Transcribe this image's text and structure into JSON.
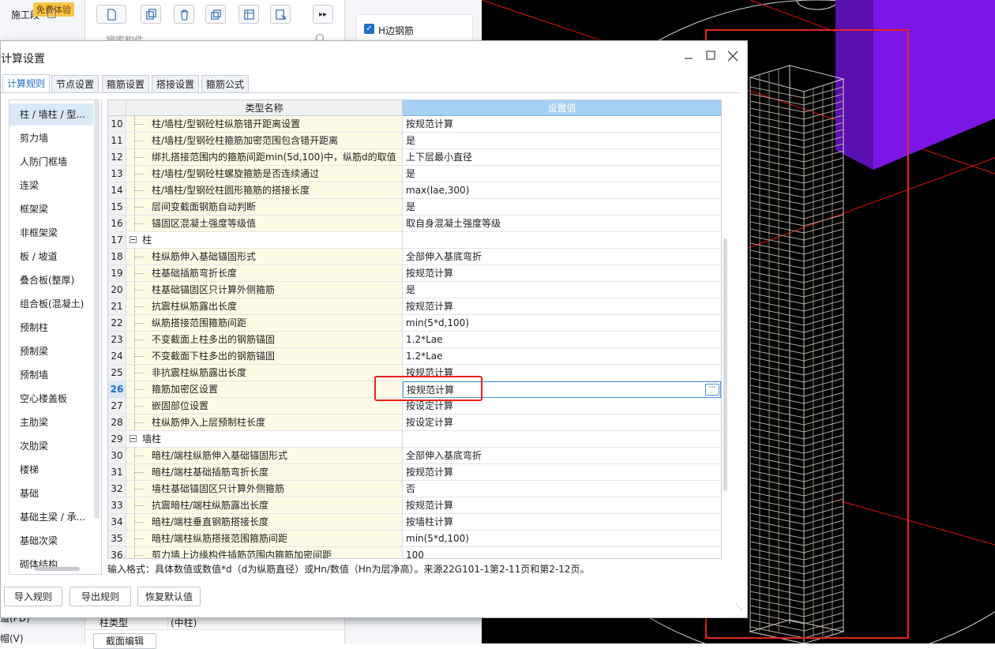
{
  "background": {
    "left_panel": {
      "stage_label": "施工段",
      "trial_badge": "免费体验",
      "bottom_items": [
        "道(PD)",
        "帽(V)"
      ]
    },
    "middle_panel": {
      "search_placeholder": "搜索构件",
      "prop_row": {
        "name": "柱类型",
        "value": "(中柱)"
      },
      "bottom_button": "截面编辑"
    },
    "property_panel": {
      "checkbox_label": "H边钢筋",
      "checked": true
    }
  },
  "dialog": {
    "title": "计算设置",
    "tabs": [
      {
        "label": "计算规则",
        "active": true
      },
      {
        "label": "节点设置"
      },
      {
        "label": "箍筋设置"
      },
      {
        "label": "搭接设置"
      },
      {
        "label": "箍筋公式"
      }
    ],
    "categories": [
      "柱 / 墙柱 / 型...",
      "剪力墙",
      "人防门框墙",
      "连梁",
      "框架梁",
      "非框架梁",
      "板 / 坡道",
      "叠合板(整厚)",
      "组合板(混凝土)",
      "预制柱",
      "预制梁",
      "预制墙",
      "空心楼盖板",
      "主肋梁",
      "次肋梁",
      "楼梯",
      "基础",
      "基础主梁 / 承...",
      "基础次梁",
      "砌体结构"
    ],
    "grid": {
      "col_name": "类型名称",
      "col_value": "设置值",
      "rows": [
        {
          "num": "10",
          "name": "柱/墙柱/型钢砼柱纵筋错开距离设置",
          "value": "按规范计算"
        },
        {
          "num": "11",
          "name": "柱/墙柱/型钢砼柱箍筋加密范围包含错开距离",
          "value": "是"
        },
        {
          "num": "12",
          "name": "绑扎搭接范围内的箍筋间距min(5d,100)中，纵筋d的取值",
          "value": "上下层最小直径"
        },
        {
          "num": "13",
          "name": "柱/墙柱/型钢砼柱螺旋箍筋是否连续通过",
          "value": "是"
        },
        {
          "num": "14",
          "name": "柱/墙柱/型钢砼柱圆形箍筋的搭接长度",
          "value": "max(lae,300)"
        },
        {
          "num": "15",
          "name": "层间变截面钢筋自动判断",
          "value": "是"
        },
        {
          "num": "16",
          "name": "锚固区混凝土强度等级值",
          "value": "取自身混凝土强度等级"
        },
        {
          "num": "17",
          "name": "柱",
          "value": "",
          "group": true
        },
        {
          "num": "18",
          "name": "柱纵筋伸入基础锚固形式",
          "value": "全部伸入基底弯折"
        },
        {
          "num": "19",
          "name": "柱基础插筋弯折长度",
          "value": "按规范计算"
        },
        {
          "num": "20",
          "name": "柱基础锚固区只计算外侧箍筋",
          "value": "是"
        },
        {
          "num": "21",
          "name": "抗震柱纵筋露出长度",
          "value": "按规范计算"
        },
        {
          "num": "22",
          "name": "纵筋搭接范围箍筋间距",
          "value": "min(5*d,100)"
        },
        {
          "num": "23",
          "name": "不变截面上柱多出的钢筋锚固",
          "value": "1.2*Lae"
        },
        {
          "num": "24",
          "name": "不变截面下柱多出的钢筋锚固",
          "value": "1.2*Lae"
        },
        {
          "num": "25",
          "name": "非抗震柱纵筋露出长度",
          "value": "按规范计算"
        },
        {
          "num": "26",
          "name": "箍筋加密区设置",
          "value": "按规范计算",
          "selected": true
        },
        {
          "num": "27",
          "name": "嵌固部位设置",
          "value": "按设定计算"
        },
        {
          "num": "28",
          "name": "柱纵筋伸入上层预制柱长度",
          "value": "按设定计算"
        },
        {
          "num": "29",
          "name": "墙柱",
          "value": "",
          "group": true
        },
        {
          "num": "30",
          "name": "暗柱/端柱纵筋伸入基础锚固形式",
          "value": "全部伸入基底弯折"
        },
        {
          "num": "31",
          "name": "暗柱/端柱基础插筋弯折长度",
          "value": "按规范计算"
        },
        {
          "num": "32",
          "name": "墙柱基础锚固区只计算外侧箍筋",
          "value": "否"
        },
        {
          "num": "33",
          "name": "抗震暗柱/端柱纵筋露出长度",
          "value": "按规范计算"
        },
        {
          "num": "34",
          "name": "暗柱/端柱垂直钢筋搭接长度",
          "value": "按墙柱计算"
        },
        {
          "num": "35",
          "name": "暗柱/端柱纵筋搭接范围箍筋间距",
          "value": "min(5*d,100)"
        },
        {
          "num": "36",
          "name": "剪力墙上边缘构件插筋范围内箍筋加密间距",
          "value": "100"
        }
      ]
    },
    "status_text": "输入格式：具体数值或数值*d（d为纵筋直径）或Hn/数值（Hn为层净高）。来源22G101-1第2-11页和第2-12页。",
    "footer_buttons": [
      "导入规则",
      "导出规则",
      "恢复默认值"
    ]
  },
  "colors": {
    "accent": "#1f6fc9",
    "header_blue": "#a8d0f3",
    "name_column_bg": "#fdfbe6",
    "highlight_red": "#e8231b",
    "viewport_bg": "#000000",
    "model_purple": "#7a17e6"
  }
}
